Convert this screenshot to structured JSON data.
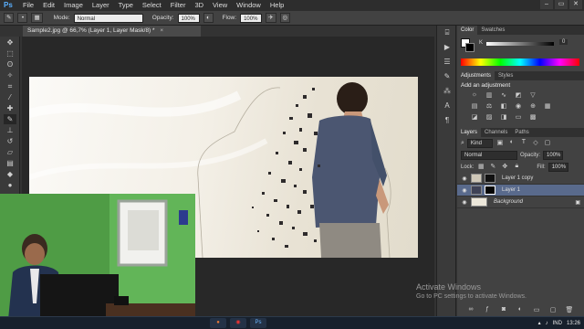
{
  "menubar": {
    "logo": "Ps",
    "items": [
      "File",
      "Edit",
      "Image",
      "Layer",
      "Type",
      "Select",
      "Filter",
      "3D",
      "View",
      "Window",
      "Help"
    ],
    "controls": [
      "–",
      "▭",
      "✕"
    ]
  },
  "options": {
    "mode_label": "Mode:",
    "mode_value": "Normal",
    "opacity_label": "Opacity:",
    "opacity_value": "100%",
    "flow_label": "Flow:",
    "flow_value": "100%"
  },
  "document": {
    "tab_title": "Sample2.jpg @ 66,7% (Layer 1, Layer Mask/8) *",
    "close": "×"
  },
  "panels": {
    "color_tabs": [
      "Color",
      "Swatches"
    ],
    "color_k_label": "K",
    "color_k_value": "0",
    "adjust_tabs": [
      "Adjustments",
      "Styles"
    ],
    "adjust_title": "Add an adjustment",
    "layers_tabs": [
      "Layers",
      "Channels",
      "Paths"
    ],
    "kind_label": "Kind",
    "blend_mode": "Normal",
    "opacity_label": "Opacity:",
    "opacity_value": "100%",
    "lock_label": "Lock:",
    "fill_label": "Fill:",
    "fill_value": "100%",
    "layers": [
      {
        "name": "Layer 1 copy",
        "active": false
      },
      {
        "name": "Layer 1",
        "active": true
      },
      {
        "name": "Background",
        "active": false
      }
    ]
  },
  "watermark": {
    "title": "Activate Windows",
    "subtitle": "Go to PC settings to activate Windows."
  },
  "taskbar": {
    "app_label": "Ps",
    "lang": "IND",
    "time": "13:26"
  },
  "colors": {
    "accent": "#5ab0ff",
    "active_layer": "#596a8c"
  }
}
